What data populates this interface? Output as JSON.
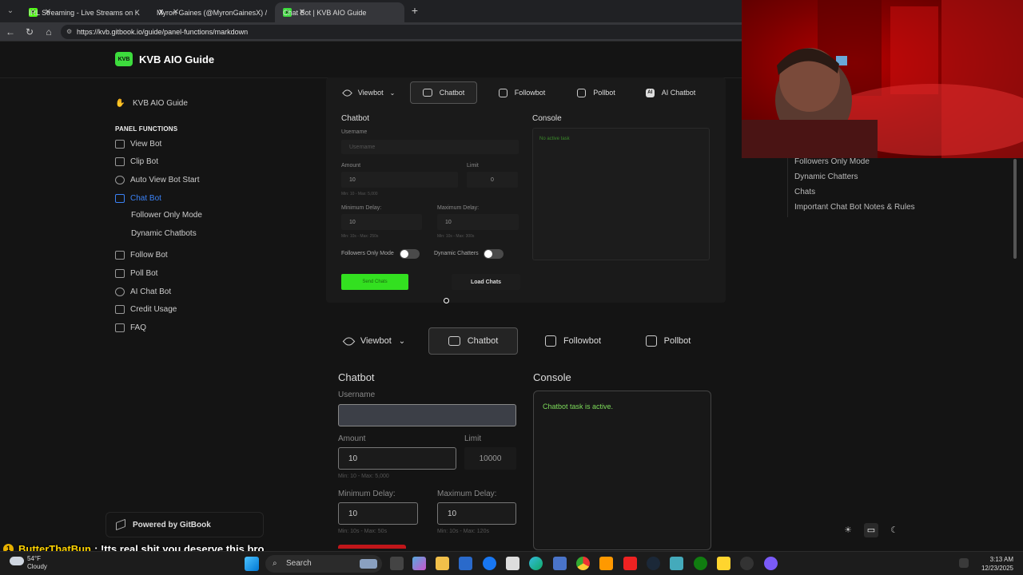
{
  "browser": {
    "tabs": [
      {
        "title": "IRL Streaming - Live Streams on K",
        "favicon": "K"
      },
      {
        "title": "Myron Gaines (@MyronGainesX) /",
        "favicon": "X"
      },
      {
        "title": "Chat Bot | KVB AIO Guide",
        "favicon": "K"
      }
    ],
    "url": "https://kvb.gitbook.io/guide/panel-functions/markdown"
  },
  "brand": {
    "logo": "KVB",
    "name": "KVB AIO Guide"
  },
  "sidebar": {
    "home": "KVB AIO Guide",
    "section": "PANEL FUNCTIONS",
    "items": [
      {
        "label": "View Bot"
      },
      {
        "label": "Clip Bot"
      },
      {
        "label": "Auto View Bot Start"
      },
      {
        "label": "Chat Bot"
      }
    ],
    "sub_items": [
      {
        "label": "Follower Only Mode"
      },
      {
        "label": "Dynamic Chatbots"
      }
    ],
    "items2": [
      {
        "label": "Follow Bot"
      },
      {
        "label": "Poll Bot"
      },
      {
        "label": "AI Chat Bot"
      },
      {
        "label": "Credit Usage"
      },
      {
        "label": "FAQ"
      }
    ],
    "footer": "Powered by GitBook"
  },
  "panel1": {
    "tabs": [
      "Viewbot",
      "Chatbot",
      "Followbot",
      "Pollbot",
      "AI Chatbot"
    ],
    "chatbot_title": "Chatbot",
    "username_label": "Username",
    "username_placeholder": "Username",
    "amount_label": "Amount",
    "amount_value": "10",
    "amount_hint": "Min: 10 - Max: 5,000",
    "limit_label": "Limit",
    "limit_value": "0",
    "min_delay_label": "Minimum Delay:",
    "min_delay_value": "10",
    "min_delay_hint": "Min: 10s - Max: 250s",
    "max_delay_label": "Maximum Delay:",
    "max_delay_value": "10",
    "max_delay_hint": "Min: 10s - Max: 300s",
    "followers_only": "Followers Only Mode",
    "dynamic_chatters": "Dynamic Chatters",
    "send_button": "Send Chats",
    "load_button": "Load Chats",
    "console_title": "Console",
    "console_text": "No active task"
  },
  "panel2": {
    "tabs": [
      "Viewbot",
      "Chatbot",
      "Followbot",
      "Pollbot"
    ],
    "chatbot_title": "Chatbot",
    "username_label": "Username",
    "amount_label": "Amount",
    "amount_value": "10",
    "amount_hint": "Min: 10 - Max: 5,000",
    "limit_label": "Limit",
    "limit_value": "10000",
    "min_delay_label": "Minimum Delay:",
    "min_delay_value": "10",
    "min_delay_hint": "Min: 10s - Max: 50s",
    "max_delay_label": "Maximum Delay:",
    "max_delay_value": "10",
    "max_delay_hint": "Min: 10s - Max: 120s",
    "console_title": "Console",
    "console_text": "Chatbot task is active."
  },
  "toc": [
    "Followers Only Mode",
    "Dynamic Chatters",
    "Chats",
    "Important Chat Bot Notes & Rules"
  ],
  "chat_overlay": {
    "badge": "1",
    "user": "ButterThatBun",
    "message": ": !tts real shit you deserve this bro"
  },
  "taskbar": {
    "temp": "54°F",
    "condition": "Cloudy",
    "search": "Search",
    "time": "3:13 AM",
    "date": "12/23/2025"
  },
  "colors": {
    "accent_green": "#3ddc3d",
    "link_blue": "#3b82f6",
    "console_green": "#7ddc5a",
    "send_green": "#33e020"
  }
}
